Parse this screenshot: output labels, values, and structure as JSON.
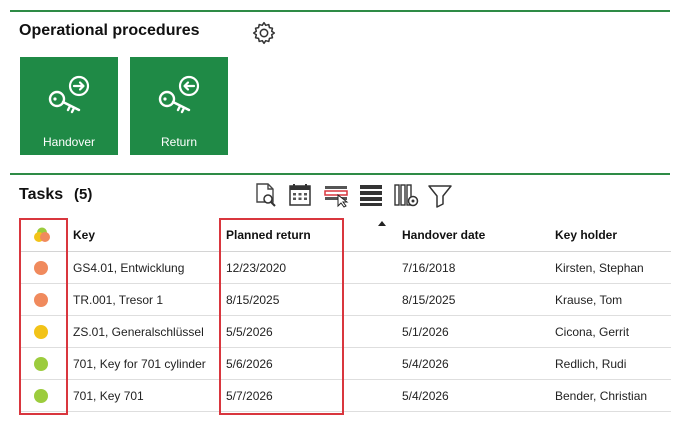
{
  "procedures": {
    "title": "Operational procedures",
    "tiles": [
      {
        "label": "Handover",
        "icon": "key-handover-icon"
      },
      {
        "label": "Return",
        "icon": "key-return-icon"
      }
    ],
    "settings_icon": "gear-icon"
  },
  "tasks": {
    "title": "Tasks",
    "count": "(5)",
    "toolbar_icons": [
      "document-search-icon",
      "calendar-icon",
      "row-select-icon",
      "rows-icon",
      "columns-settings-icon",
      "filter-icon"
    ],
    "columns": {
      "status": "",
      "key": "Key",
      "planned_return": "Planned return",
      "handover_date": "Handover date",
      "key_holder": "Key holder"
    },
    "rows": [
      {
        "status_color": "#f08a5d",
        "key": "GS4.01, Entwicklung",
        "planned_return": "12/23/2020",
        "handover_date": "7/16/2018",
        "key_holder": "Kirsten, Stephan"
      },
      {
        "status_color": "#f08a5d",
        "key": "TR.001, Tresor 1",
        "planned_return": "8/15/2025",
        "handover_date": "8/15/2025",
        "key_holder": "Krause, Tom"
      },
      {
        "status_color": "#f2c318",
        "key": "ZS.01, Generalschlüssel",
        "planned_return": "5/5/2026",
        "handover_date": "5/1/2026",
        "key_holder": "Cicona, Gerrit"
      },
      {
        "status_color": "#9ccc3d",
        "key": "701, Key for 701 cylinder",
        "planned_return": "5/6/2026",
        "handover_date": "5/4/2026",
        "key_holder": "Redlich, Rudi"
      },
      {
        "status_color": "#9ccc3d",
        "key": "701, Key 701",
        "planned_return": "5/7/2026",
        "handover_date": "5/4/2026",
        "key_holder": "Bender, Christian"
      }
    ]
  },
  "colors": {
    "accent": "#1f8a46",
    "highlight": "#d9363e"
  }
}
